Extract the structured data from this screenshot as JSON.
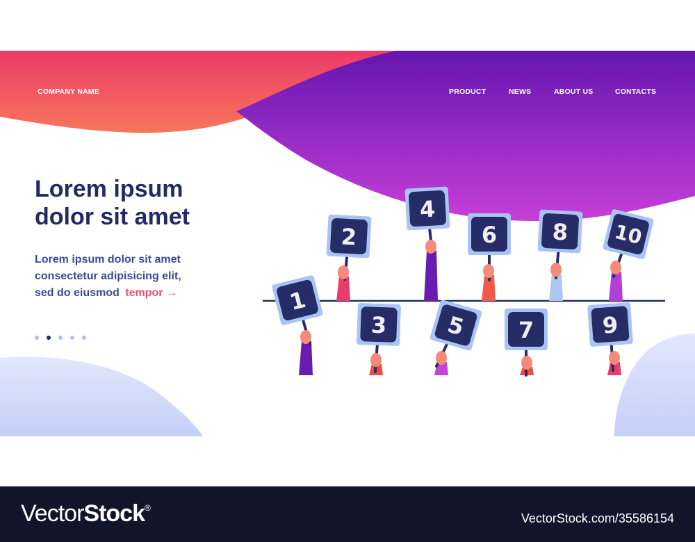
{
  "header": {
    "company_name": "COMPANY NAME",
    "nav": [
      {
        "label": "PRODUCT"
      },
      {
        "label": "NEWS"
      },
      {
        "label": "ABOUT US"
      },
      {
        "label": "CONTACTS"
      }
    ]
  },
  "hero": {
    "headline_line1": "Lorem ipsum",
    "headline_line2": "dolor sit amet",
    "body_line1": "Lorem ipsum dolor sit amet",
    "body_line2": "consectetur adipisicing elit,",
    "body_line3": "sed do eiusmod",
    "link_label": "tempor",
    "link_arrow": "→"
  },
  "pagination": {
    "total": 5,
    "active_index": 1
  },
  "illustration": {
    "description": "Hands raising score cards",
    "cards": [
      "1",
      "2",
      "3",
      "4",
      "5",
      "6",
      "7",
      "8",
      "9",
      "10"
    ]
  },
  "colors": {
    "header_warm_top": "#ec3a68",
    "header_warm_bottom": "#f7755a",
    "header_purple_top": "#6a17b3",
    "header_purple_bottom": "#c13fd8",
    "headline": "#232a63",
    "body": "#3b4a91",
    "accent": "#f0506a",
    "blob_light": "#dfe5fb",
    "card_dark": "#262d66",
    "card_border": "#a9c4f2",
    "footer_bg": "#12142a"
  },
  "footer": {
    "brand_light": "Vector",
    "brand_bold": "Stock",
    "brand_mark": "®",
    "reference": "VectorStock.com/35586154"
  }
}
